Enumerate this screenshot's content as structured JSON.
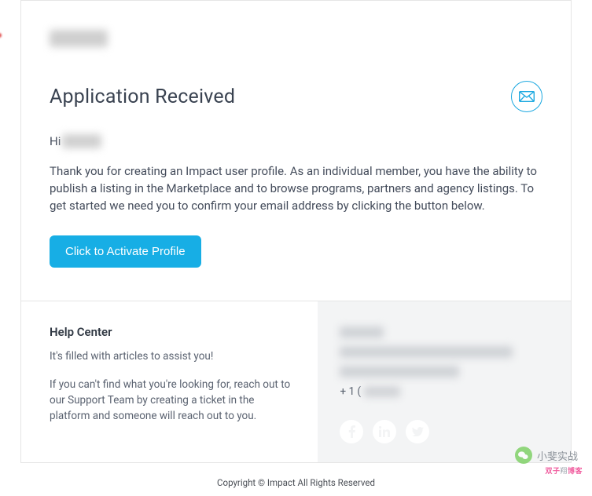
{
  "header": {
    "title": "Application Received"
  },
  "greeting": {
    "prefix": "Hi"
  },
  "body": {
    "paragraph": "Thank you for creating an Impact user profile. As an individual member, you have the ability to publish a listing in the Marketplace and to browse programs, partners and agency listings. To get started we need you to confirm your email address by clicking the button below."
  },
  "cta": {
    "label": "Click to Activate Profile"
  },
  "help": {
    "title": "Help Center",
    "line1": "It's filled with articles to assist you!",
    "line2": "If you can't find what you're looking for, reach out to our Support Team by creating a ticket in the platform and someone will reach out to you."
  },
  "contact": {
    "phone_prefix": "+ 1 ("
  },
  "footer": {
    "copyright": "Copyright © Impact All Rights Reserved"
  },
  "watermark": {
    "text": "小斐实战",
    "brand1": "双子",
    "brand2": "博客"
  }
}
